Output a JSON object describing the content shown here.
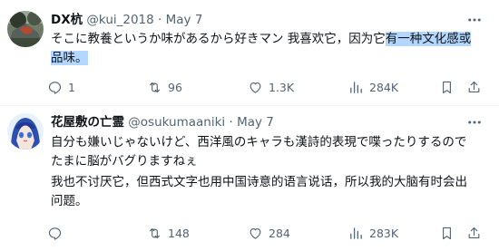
{
  "tweet1": {
    "name": "DX杭",
    "handle": "@kui_2018",
    "dot": "·",
    "date": "May 7",
    "text_line1_pre": "そこに教養というか味があるから好きマン 我喜欢它，因为它",
    "text_line1_hl": "有一种文化感或",
    "text_line2_hl": "品味。",
    "stats": {
      "replies": "1",
      "reposts": "96",
      "likes": "1.3K",
      "views": "284K"
    }
  },
  "tweet2": {
    "name": "花屋敷の亡霊",
    "handle": "@osukumaaniki",
    "dot": "·",
    "date": "May 7",
    "text_line1": "自分も嫌いじゃないけど、西洋風のキャラも漢詩的表現で喋ったりするので",
    "text_line2": "たまに脳がバグりますねぇ",
    "text_line3": "我也不讨厌它，但西式文字也用中国诗意的语言说话，所以我的大脑有时会出",
    "text_line4": "问题。",
    "stats": {
      "replies": "",
      "reposts": "148",
      "likes": "284",
      "views": "283K"
    }
  },
  "icons": {
    "more": "more-icon",
    "reply": "reply-icon",
    "repost": "repost-icon",
    "like": "heart-icon",
    "views": "views-icon",
    "bookmark": "bookmark-icon",
    "share": "share-icon"
  },
  "colors": {
    "text": "#0f1419",
    "secondary": "#536471",
    "highlight": "#b3d7fe",
    "divider": "#eff3f4"
  }
}
